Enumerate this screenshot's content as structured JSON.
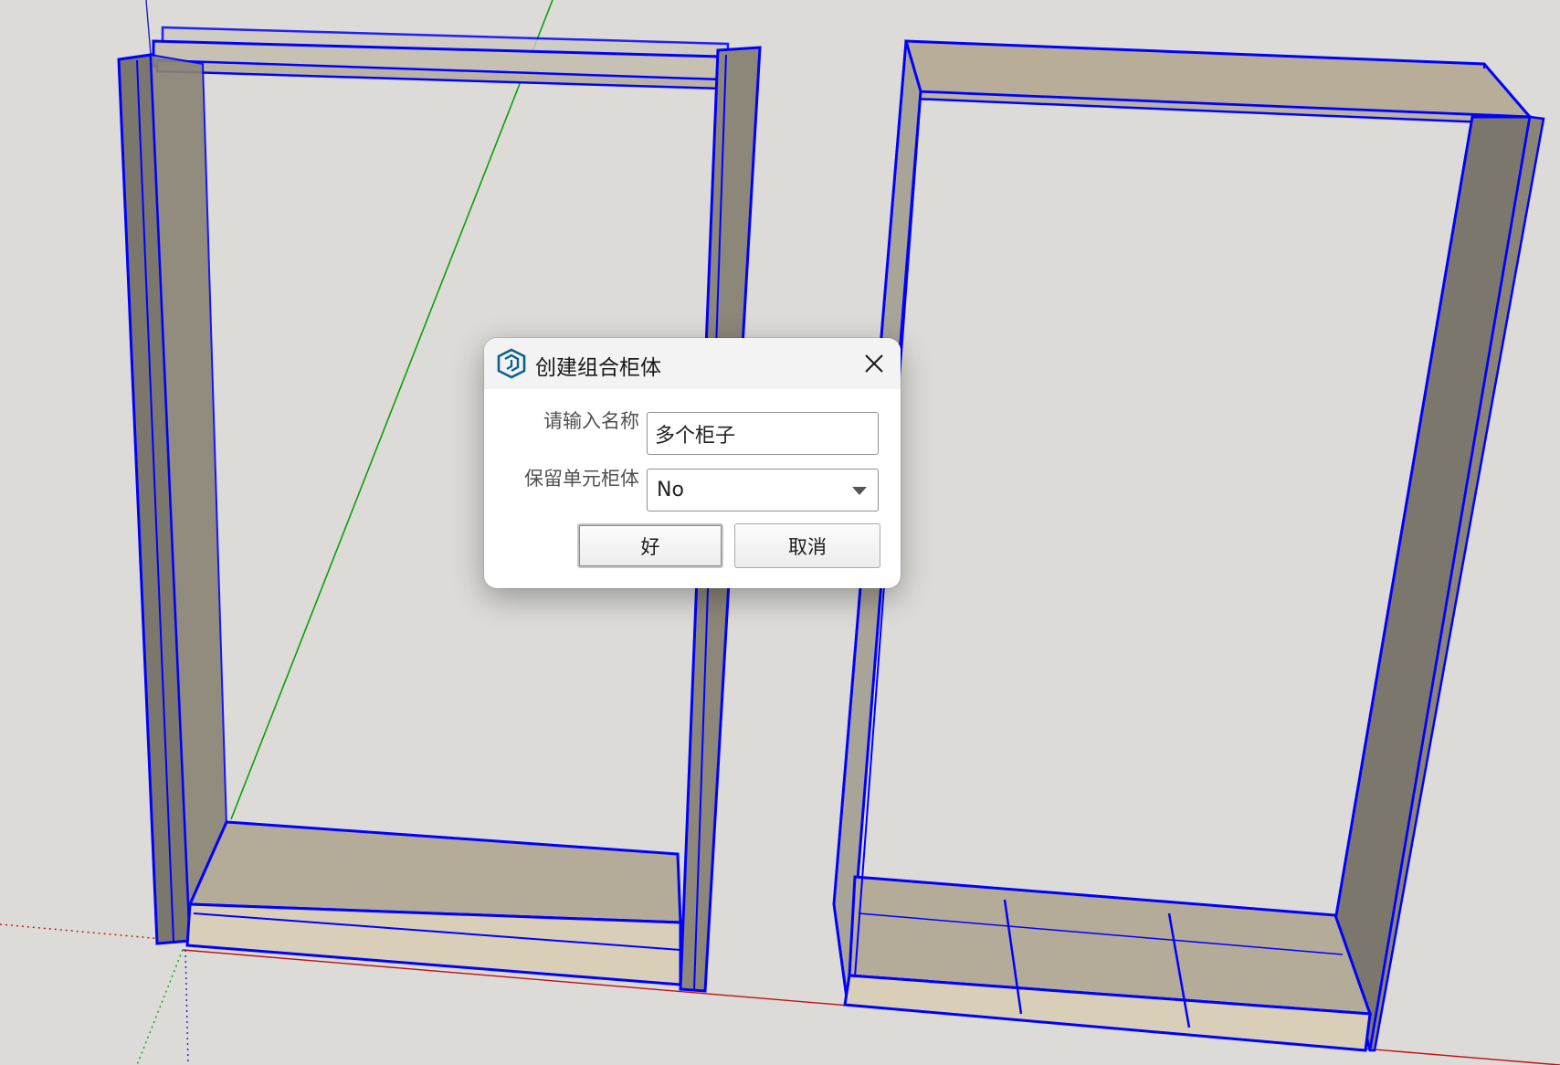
{
  "dialog": {
    "title": "创建组合柜体",
    "name_label": "请输入名称",
    "name_value": "多个柜子",
    "keep_label": "保留单元柜体",
    "keep_value": "No",
    "ok_label": "好",
    "cancel_label": "取消"
  },
  "icons": {
    "app": "sketchup-logo-icon",
    "close": "close-icon",
    "dropdown": "chevron-down-icon"
  },
  "colors": {
    "selection_edge": "#0000ff",
    "axis_green": "#00a000",
    "axis_red": "#c00000",
    "axis_blue": "#0000c0",
    "panel_side": "#7c776c",
    "panel_top": "#b4ab98",
    "background": "#dcdbd8",
    "app_icon": "#0c5f8e"
  }
}
